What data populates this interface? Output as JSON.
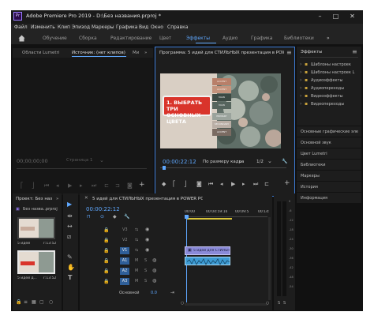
{
  "window": {
    "app_icon": "Pr",
    "title": "Adobe Premiere Pro 2019 - D:\\Без названия.prproj *",
    "minimize": "–",
    "maximize": "□",
    "close": "✕"
  },
  "menu": [
    "Файл",
    "Изменить",
    "Клип",
    "Эпизод",
    "Маркеры",
    "Графика",
    "Вид",
    "Окно",
    "Справка"
  ],
  "workspaces": [
    "Обучение",
    "Сборка",
    "Редактирование",
    "Цвет",
    "Эффекты",
    "Аудио",
    "Графика",
    "Библиотеки"
  ],
  "workspace_menu": "»",
  "source": {
    "tabs": [
      "Области Lumetri",
      "Источник: (нет клипов)",
      "Ми",
      "»"
    ],
    "timecode": "00;00;00;00",
    "dropdown": "Страница 1"
  },
  "program": {
    "title": "Программа: 5 идей для СТИЛЬНЫХ презентация в POWER POINT",
    "menu": "≡",
    "slide_heading": "1. ВЫБРАТЬ ТРИ ОСНОВНЫХ ЦВЕТА",
    "swatch_labels": [
      "ACCENT",
      "ACCENT",
      "MAIN",
      "MAIN",
      "PRIMARY",
      "SECONDARY",
      "ACCENT"
    ],
    "timecode": "00:00:22:12",
    "fit": "По размеру кадра",
    "quality": "1/2",
    "wrench": "🔧",
    "add": "+"
  },
  "effects": {
    "title": "Эффекты",
    "menu": "≡",
    "tree": [
      "Шаблоны настроек",
      "Шаблоны настроек L",
      "Аудиоэффекты",
      "Аудиопереходы",
      "Видеоэффекты",
      "Видеопереходы"
    ],
    "side_tabs": [
      "Основные графические эле",
      "Основной звук",
      "Цвет Lumetri",
      "Библиотеки",
      "Маркеры",
      "История",
      "Информация"
    ]
  },
  "project": {
    "tab": "Проект: Без наз",
    "filename": "Без назва..prproj",
    "clips": [
      {
        "name": "5 идей",
        "duration": "7:13:52"
      },
      {
        "name": "5 идей д...",
        "duration": "7:13:52"
      }
    ]
  },
  "tools": [
    "▶",
    "⇹",
    "↔",
    "⧄",
    "✎",
    "✋",
    "T"
  ],
  "timeline": {
    "tab": "5 идей для СТИЛЬНЫХ презентация в POWER POINT",
    "timecode": "00:00:22:12",
    "ruler": [
      "00:00",
      "00:04:59:16",
      "00:09:5",
      "00:14:"
    ],
    "video_tracks": [
      "V3",
      "V2",
      "V1"
    ],
    "audio_tracks": [
      "A1",
      "A2",
      "A3"
    ],
    "video_clip": "5 идей для СТИЛЬН",
    "master": "Основной",
    "master_level": "0.0"
  },
  "meter": {
    "scale": [
      "0",
      "-6",
      "-12",
      "-18",
      "-24",
      "-30",
      "-36",
      "-42",
      "-48",
      "-54"
    ],
    "solo": "S"
  },
  "colors": {
    "accent": "#5fa8ff",
    "panel_bg": "#1d1d1d",
    "slide_red": "#d9342b",
    "video_clip": "#8a8ad8",
    "audio_clip": "#3d9bd3"
  }
}
